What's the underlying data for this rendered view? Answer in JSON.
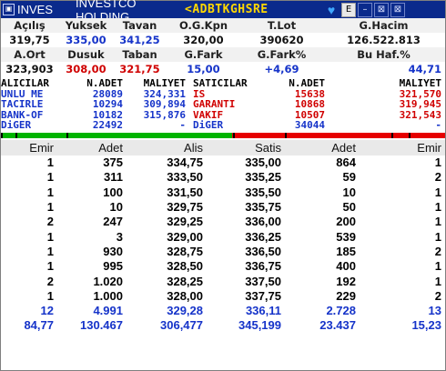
{
  "title_bar": {
    "code": "INVES",
    "name": "INVESTCO HOLDING",
    "ticker_text": "<ADBTKGHSRE",
    "buttons": [
      "E",
      "–",
      "⊠",
      "⊠"
    ]
  },
  "stats": {
    "row1_headers": [
      "Açılış",
      "Yuksek",
      "Tavan",
      "O.G.Kpn",
      "T.Lot",
      "G.Hacim"
    ],
    "row1_values": [
      "319,75",
      "335,00",
      "341,25",
      "320,00",
      "390620",
      "126.522.813"
    ],
    "row2_headers": [
      "A.Ort",
      "Dusuk",
      "Taban",
      "G.Fark",
      "G.Fark%",
      "Bu Haf.%"
    ],
    "row2_values": [
      "323,903",
      "308,00",
      "321,75",
      "15,00",
      "+4,69",
      "44,71"
    ]
  },
  "depth": {
    "headers": [
      "ALICILAR",
      "N.ADET",
      "MALIYET",
      "SATICILAR",
      "N.ADET",
      "MALIYET"
    ],
    "rows": [
      [
        "UNLU ME",
        "28089",
        "324,331",
        "IS",
        "15638",
        "321,570"
      ],
      [
        "TACIRLE",
        "10294",
        "309,894",
        "GARANTI",
        "10868",
        "319,945"
      ],
      [
        "BANK-OF",
        "10182",
        "315,876",
        "VAKIF",
        "10507",
        "321,543"
      ],
      [
        "DiGER",
        "22492",
        "-",
        "DiGER",
        "34044",
        "-"
      ]
    ]
  },
  "progress": {
    "buy_fraction": 0.52
  },
  "book": {
    "headers": [
      "Emir",
      "Adet",
      "Alis",
      "Satis",
      "Adet",
      "Emir"
    ],
    "rows": [
      [
        "1",
        "375",
        "334,75",
        "335,00",
        "864",
        "1"
      ],
      [
        "1",
        "311",
        "333,50",
        "335,25",
        "59",
        "2"
      ],
      [
        "1",
        "100",
        "331,50",
        "335,50",
        "10",
        "1"
      ],
      [
        "1",
        "10",
        "329,75",
        "335,75",
        "50",
        "1"
      ],
      [
        "2",
        "247",
        "329,25",
        "336,00",
        "200",
        "1"
      ],
      [
        "1",
        "3",
        "329,00",
        "336,25",
        "539",
        "1"
      ],
      [
        "1",
        "930",
        "328,75",
        "336,50",
        "185",
        "2"
      ],
      [
        "1",
        "995",
        "328,50",
        "336,75",
        "400",
        "1"
      ],
      [
        "2",
        "1.020",
        "328,25",
        "337,50",
        "192",
        "1"
      ],
      [
        "1",
        "1.000",
        "328,00",
        "337,75",
        "229",
        "2"
      ]
    ],
    "totals": [
      [
        "12",
        "4.991",
        "329,28",
        "336,11",
        "2.728",
        "13"
      ],
      [
        "84,77",
        "130.467",
        "306,477",
        "345,199",
        "23.437",
        "15,23"
      ]
    ]
  },
  "colors": {
    "title_bg": "#0a2a8c",
    "ticker": "#ffd800",
    "accent_blue": "#1533c9",
    "accent_red": "#d00000",
    "buy_bar": "#00b400",
    "sell_bar": "#e60000"
  }
}
